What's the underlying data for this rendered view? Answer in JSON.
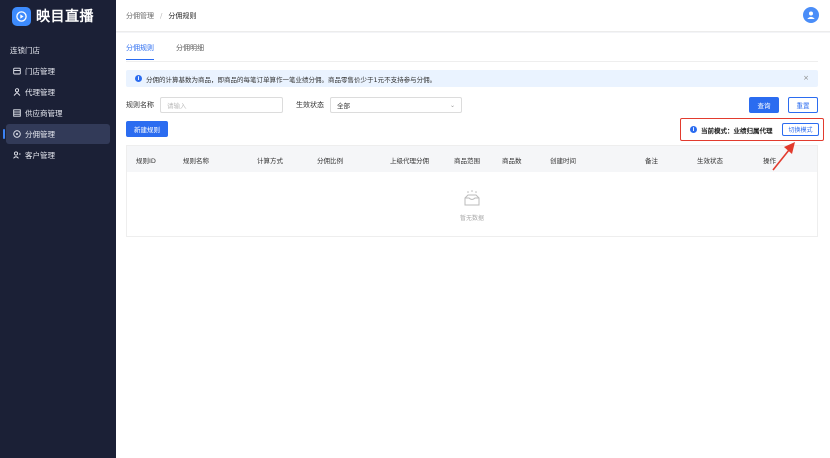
{
  "app": {
    "title": "映目直播"
  },
  "sidebar": {
    "items": [
      {
        "label": "连锁门店",
        "icon": "none"
      },
      {
        "label": "门店管理",
        "icon": "store-icon"
      },
      {
        "label": "代理管理",
        "icon": "agent-icon"
      },
      {
        "label": "供应商管理",
        "icon": "supplier-icon"
      },
      {
        "label": "分佣管理",
        "icon": "commission-icon",
        "active": true
      },
      {
        "label": "客户管理",
        "icon": "customer-icon"
      }
    ]
  },
  "breadcrumb": {
    "parent": "分佣管理",
    "separator": "/",
    "current": "分佣规则"
  },
  "tabs": [
    {
      "label": "分佣规则",
      "active": true
    },
    {
      "label": "分佣明细",
      "active": false
    }
  ],
  "alert": {
    "text": "分佣的计算基数为商品，即商品的每笔订单算作一笔业绩分佣。商品零售价少于1元不支持参与分佣。",
    "close": "×"
  },
  "filters": {
    "rule_name_label": "规则名称",
    "rule_name_placeholder": "请输入",
    "status_label": "生效状态",
    "status_value": "全部"
  },
  "buttons": {
    "search": "查询",
    "reset": "重置",
    "new_rule": "新建规则",
    "switch_mode": "切换模式"
  },
  "mode": {
    "label": "当前模式：",
    "value": "业绩归属代理"
  },
  "table": {
    "columns": [
      "规则ID",
      "规则名称",
      "计算方式",
      "分佣比例",
      "上级代理分佣",
      "商品范围",
      "商品数",
      "创建时间",
      "备注",
      "生效状态",
      "操作"
    ],
    "empty_text": "暂无数据"
  },
  "colors": {
    "primary": "#2b6cf0",
    "sidebar": "#1b2036",
    "highlight": "#e23b2e"
  }
}
